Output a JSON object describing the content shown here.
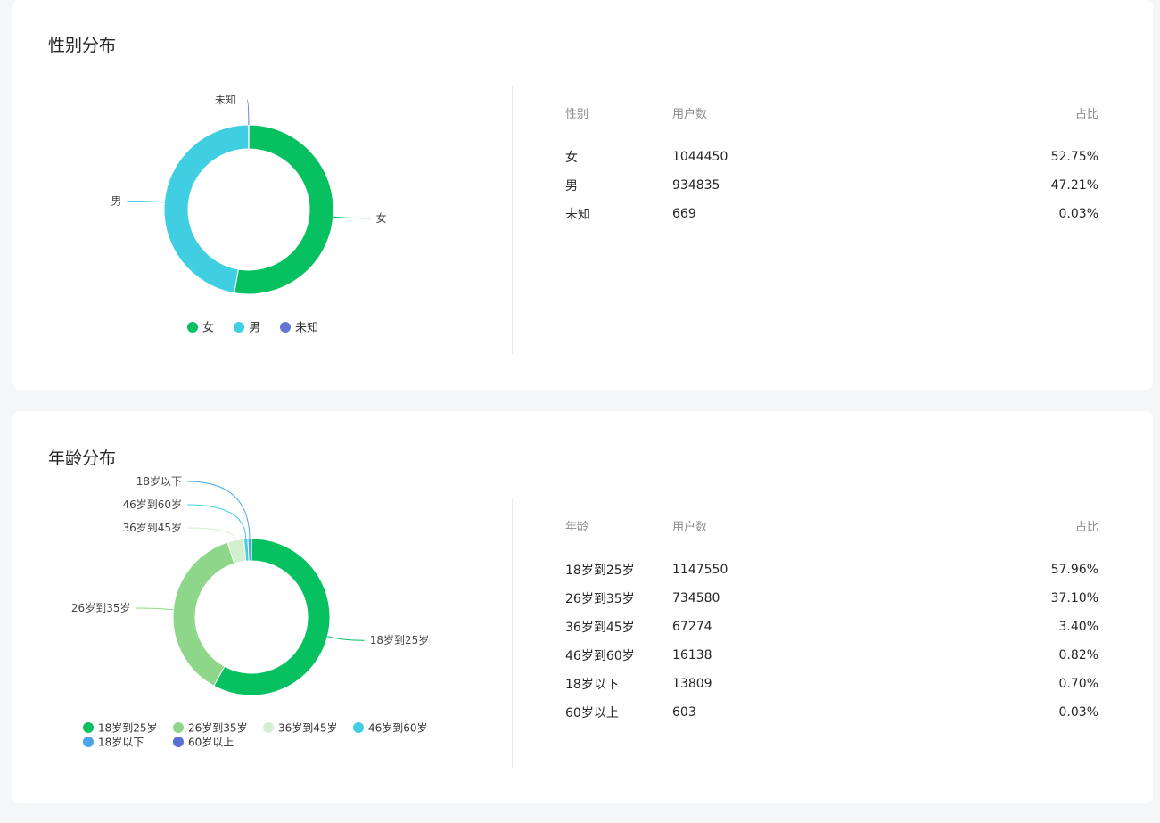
{
  "gender": {
    "title": "性别分布",
    "columns": [
      "性别",
      "用户数",
      "占比"
    ],
    "rows": [
      {
        "label": "女",
        "count": "1044450",
        "pct": "52.75%"
      },
      {
        "label": "男",
        "count": "934835",
        "pct": "47.21%"
      },
      {
        "label": "未知",
        "count": "669",
        "pct": "0.03%"
      }
    ]
  },
  "age": {
    "title": "年龄分布",
    "columns": [
      "年龄",
      "用户数",
      "占比"
    ],
    "rows": [
      {
        "label": "18岁到25岁",
        "count": "1147550",
        "pct": "57.96%"
      },
      {
        "label": "26岁到35岁",
        "count": "734580",
        "pct": "37.10%"
      },
      {
        "label": "36岁到45岁",
        "count": "67274",
        "pct": "3.40%"
      },
      {
        "label": "46岁到60岁",
        "count": "16138",
        "pct": "0.82%"
      },
      {
        "label": "18岁以下",
        "count": "13809",
        "pct": "0.70%"
      },
      {
        "label": "60岁以上",
        "count": "603",
        "pct": "0.03%"
      }
    ]
  },
  "chart_data": [
    {
      "type": "pie",
      "variant": "donut",
      "categories": [
        "女",
        "男",
        "未知"
      ],
      "values": [
        1044450,
        934835,
        669
      ],
      "percentages": [
        52.75,
        47.21,
        0.03
      ],
      "colors": [
        "#07c160",
        "#40cfe2",
        "#6476d1"
      ],
      "legend_position": "bottom",
      "slice_labels": [
        "女",
        "男",
        "未知"
      ]
    },
    {
      "type": "pie",
      "variant": "donut",
      "categories": [
        "18岁到25岁",
        "26岁到35岁",
        "36岁到45岁",
        "46岁到60岁",
        "18岁以下",
        "60岁以上"
      ],
      "values": [
        1147550,
        734580,
        67274,
        16138,
        13809,
        603
      ],
      "percentages": [
        57.96,
        37.1,
        3.4,
        0.82,
        0.7,
        0.03
      ],
      "colors": [
        "#07c160",
        "#8ed68a",
        "#d2efd0",
        "#40cfe2",
        "#4aa6e8",
        "#5a6fd0"
      ],
      "legend_position": "bottom",
      "slice_labels": [
        "18岁到25岁",
        "26岁到35岁",
        "36岁到45岁",
        "46岁到60岁",
        "18岁以下"
      ]
    }
  ]
}
